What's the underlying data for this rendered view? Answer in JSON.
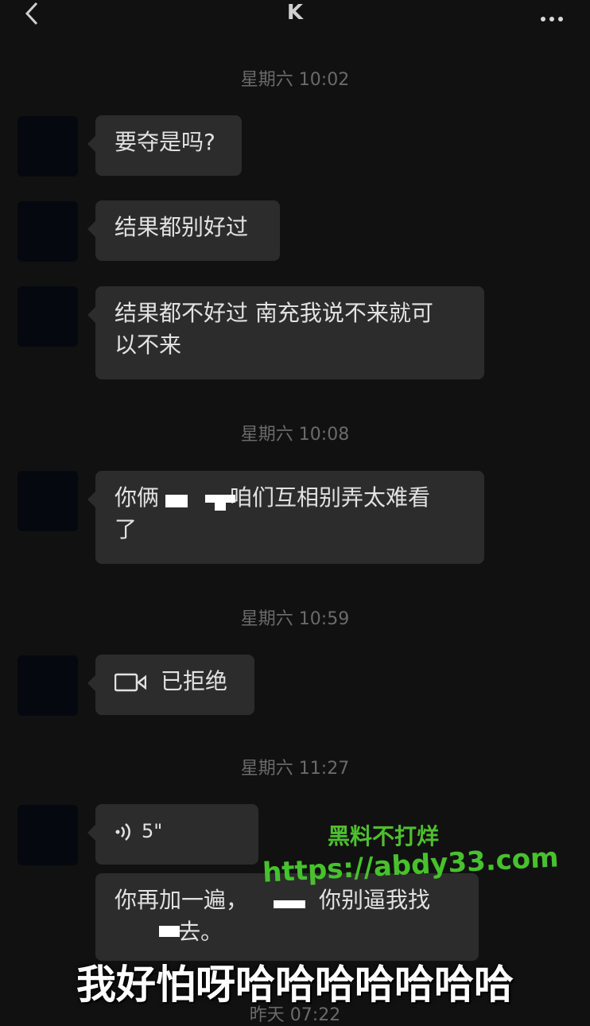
{
  "header": {
    "title": "K"
  },
  "timestamps": [
    "星期六 10:02",
    "星期六 10:08",
    "星期六 10:59",
    "星期六 11:27",
    "昨天 07:22"
  ],
  "messages": [
    {
      "text": "要夺是吗?"
    },
    {
      "text": "结果都别好过"
    },
    {
      "text_line1": "结果都不好过 南充我说不来就可",
      "text_line2": "以不来"
    },
    {
      "text_line1": "你俩          咱们互相别弄太难看",
      "text_line2": "了"
    },
    {
      "text": "已拒绝",
      "icon": "video-camera-icon"
    },
    {
      "text": "5\"",
      "icon": "voice-icon"
    },
    {
      "text_line1": "你再加一遍，          你别逼我找",
      "text_line2": "         去。"
    }
  ],
  "watermark": {
    "line1": "黑料不打烊",
    "line2": "https://abdy33.com"
  },
  "caption": "我好怕呀哈哈哈哈哈哈哈",
  "colors": {
    "background": "#111111",
    "bubble": "#2c2c2c",
    "watermark": "#4fbf2f"
  }
}
